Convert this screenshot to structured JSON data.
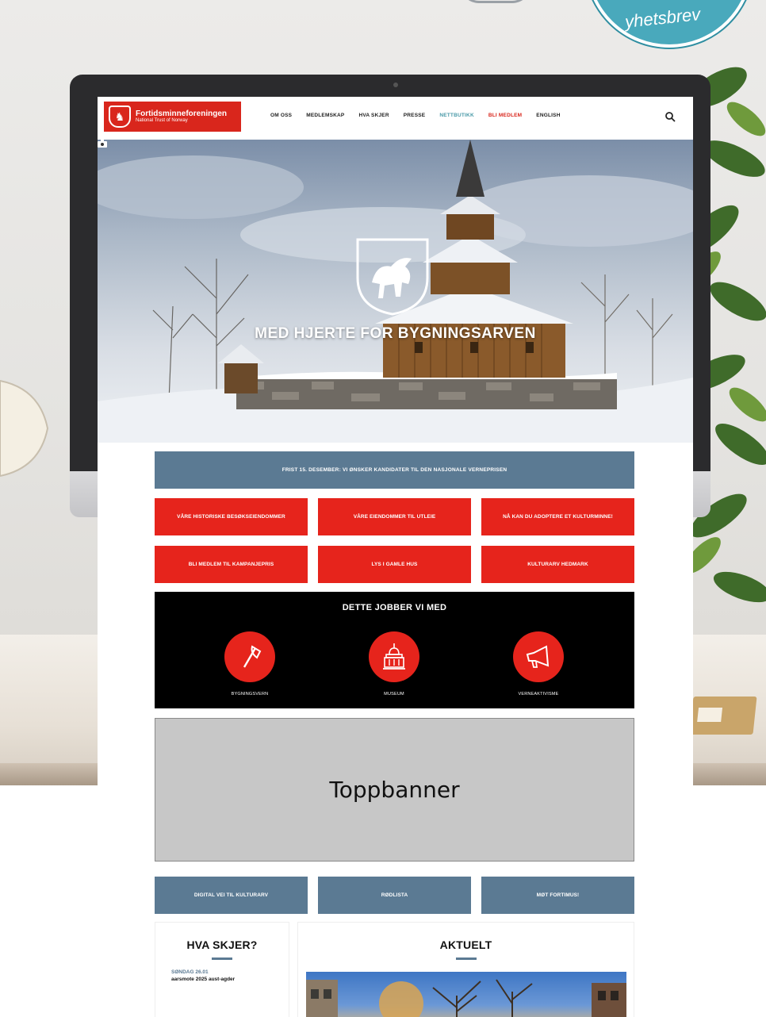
{
  "badge": {
    "label": "yhetsbrev"
  },
  "site": {
    "logo": {
      "name": "Fortidsminneforeningen",
      "subtitle": "National Trust of Norway"
    },
    "nav": [
      "OM OSS",
      "MEDLEMSKAP",
      "HVA SKJER",
      "PRESSE",
      "NETTBUTIKK",
      "BLI MEDLEM",
      "ENGLISH"
    ],
    "hero": {
      "title": "MED HJERTE FOR BYGNINGSARVEN"
    },
    "notice": "FRIST 15. DESEMBER: VI ØNSKER KANDIDATER TIL DEN NASJONALE VERNEPRISEN",
    "red_buttons": [
      "VÅRE HISTORISKE BESØKSEIENDOMMER",
      "VÅRE EIENDOMMER TIL UTLEIE",
      "NÅ KAN DU ADOPTERE ET KULTURMINNE!",
      "BLI MEDLEM TIL KAMPANJEPRIS",
      "LYS I GAMLE HUS",
      "KULTURARV HEDMARK"
    ],
    "work": {
      "title": "DETTE JOBBER VI MED",
      "items": [
        {
          "label": "BYGNINGSVERN",
          "icon": "axe-icon"
        },
        {
          "label": "MUSEUM",
          "icon": "museum-icon"
        },
        {
          "label": "VERNEAKTIVISME",
          "icon": "megaphone-icon"
        }
      ]
    },
    "topbanner": "Toppbanner",
    "blue_buttons": [
      "DIGITAL VEI TIL KULTURARV",
      "RØDLISTA",
      "MØT FORTIMUS!"
    ],
    "events": {
      "title": "HVA SKJER?",
      "items": [
        {
          "date": "SØNDAG 26.01",
          "name": "aarsmote 2025 aust-agder"
        }
      ]
    },
    "news": {
      "title": "AKTUELT"
    }
  },
  "colors": {
    "brand_red": "#e6241c",
    "slate_blue": "#5b7a93",
    "shop_teal": "#4a9aa8"
  }
}
